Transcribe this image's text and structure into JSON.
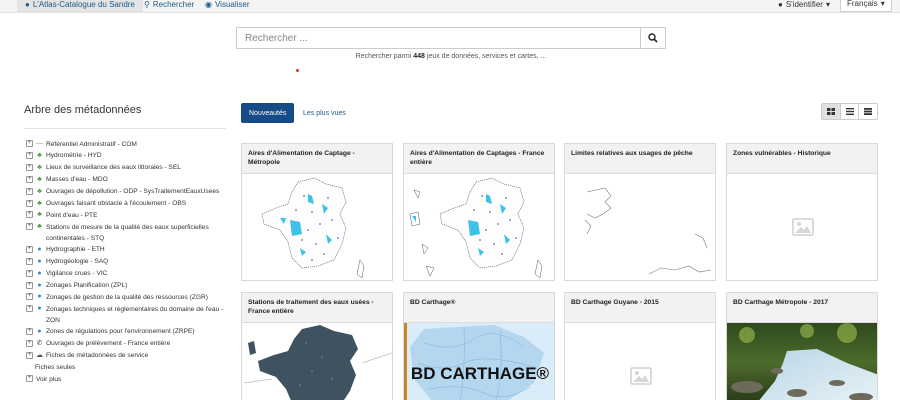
{
  "nav": {
    "catalog": "L'Atlas-Catalogue du Sandre",
    "search": "Rechercher",
    "visualize": "Visualiser",
    "login": "S'identifier",
    "language": "Français"
  },
  "search": {
    "placeholder": "Rechercher ...",
    "hint_prefix": "Rechercher parmi",
    "hint_count": "448",
    "hint_suffix": "jeux de données, services et cartes, ..."
  },
  "tree": {
    "title": "Arbre des métadonnées",
    "items": [
      {
        "label": "Référentiel Administratif - COM",
        "icon": "minus-icon"
      },
      {
        "label": "Hydrométrie - HYD",
        "icon": "tree-icon"
      },
      {
        "label": "Lieux de surveillance des eaux littorales - SEL",
        "icon": "tree-icon"
      },
      {
        "label": "Masses d'eau - MDO",
        "icon": "tree-icon"
      },
      {
        "label": "Ouvrages de dépollution - ODP - SysTraitementEauxUsees",
        "icon": "tree-icon"
      },
      {
        "label": "Ouvrages faisant obstacle à l'écoulement - OBS",
        "icon": "tree-icon"
      },
      {
        "label": "Point d'eau - PTE",
        "icon": "tree-icon"
      },
      {
        "label": "Stations de mesure de la qualité des eaux superficielles continentales - STQ",
        "icon": "tree-icon"
      },
      {
        "label": "Hydrographie - ETH",
        "icon": "drop-icon"
      },
      {
        "label": "Hydrogéologie - SAQ",
        "icon": "drop-icon"
      },
      {
        "label": "Vigilance crues - VIC",
        "icon": "drop-icon"
      },
      {
        "label": "Zonages Planification (ZPL)",
        "icon": "drop-icon"
      },
      {
        "label": "Zonages de gestion de la qualité des ressources (ZGR)",
        "icon": "drop-icon"
      },
      {
        "label": "Zonages techniques et réglementaires du domaine de l'eau - ZON",
        "icon": "drop-icon"
      },
      {
        "label": "Zones de régulations pour l'environnement (ZRPE)",
        "icon": "drop-icon"
      },
      {
        "label": "Ouvrages de prélèvement - France entière",
        "icon": "phone-icon"
      },
      {
        "label": "Fiches de métadonnées de service",
        "icon": "cloud-icon"
      }
    ],
    "plain_items": [
      "Fiches seules",
      "Voir plus"
    ]
  },
  "tabs": {
    "latest": "Nouveautés",
    "most_viewed": "Les plus vues"
  },
  "cards": [
    {
      "title": "Aires d'Alimentation de Captage - Métropole",
      "image": "map-metropole"
    },
    {
      "title": "Aires d'Alimentation de Captages - France entière",
      "image": "map-france"
    },
    {
      "title": "Limites relatives aux usages de pêche",
      "image": "map-outline"
    },
    {
      "title": "Zones vulnérables - Historique",
      "image": "placeholder-image-icon"
    },
    {
      "title": "Stations de traitement des eaux usées - France entière",
      "image": "map-dark"
    },
    {
      "title": "BD Carthage®",
      "image": "bd-carthage-logo",
      "overlay": "BD CARTHAGE®"
    },
    {
      "title": "BD Carthage Guyane - 2015",
      "image": "placeholder-image-icon"
    },
    {
      "title": "BD Carthage Métropole - 2017",
      "image": "river-photo"
    }
  ],
  "colors": {
    "accent": "#174b87",
    "link": "#1b5a8a",
    "card_header": "#f2f2f2",
    "aac_fill": "#3fc0e8"
  }
}
